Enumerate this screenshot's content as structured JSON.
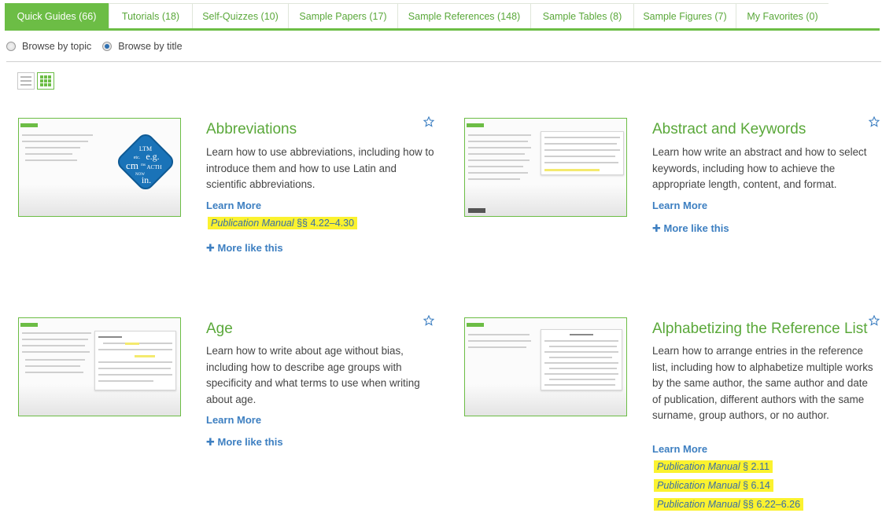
{
  "tabs": [
    {
      "label": "Quick Guides (66)",
      "active": true
    },
    {
      "label": "Tutorials (18)",
      "active": false
    },
    {
      "label": "Self-Quizzes (10)",
      "active": false
    },
    {
      "label": "Sample Papers (17)",
      "active": false
    },
    {
      "label": "Sample References (148)",
      "active": false
    },
    {
      "label": "Sample Tables (8)",
      "active": false
    },
    {
      "label": "Sample Figures (7)",
      "active": false
    },
    {
      "label": "My Favorites (0)",
      "active": false
    }
  ],
  "browse": {
    "by_topic": "Browse by topic",
    "by_title": "Browse by title",
    "selected": "by_title"
  },
  "view": {
    "list_icon": "list-view-icon",
    "grid_icon": "grid-view-icon",
    "selected": "grid"
  },
  "colors": {
    "accent": "#6cbd45",
    "link": "#3d7fc1",
    "highlight": "#fbf22f"
  },
  "thumb_badge": {
    "text": "LTM etc. e.g. cm ms ACTH NOW in."
  },
  "cards": [
    {
      "title": "Abbreviations",
      "description": "Learn how to use abbreviations, including how to introduce them and how to use Latin and scientific abbreviations.",
      "learn_more": "Learn More",
      "refs": [
        {
          "prefix": "Publication Manual",
          "section": " §§ 4.22–4.30"
        }
      ],
      "more_like_this": "More like this"
    },
    {
      "title": "Abstract and Keywords",
      "description": "Learn how write an abstract and how to select keywords, including how to achieve the appropriate length, content, and format.",
      "learn_more": "Learn More",
      "refs": [],
      "more_like_this": "More like this"
    },
    {
      "title": "Age",
      "description": "Learn how to write about age without bias, including how to describe age groups with specificity and what terms to use when writing about age.",
      "learn_more": "Learn More",
      "refs": [],
      "more_like_this": "More like this"
    },
    {
      "title": "Alphabetizing the Reference List",
      "description": "Learn how to arrange entries in the reference list, including how to alphabetize multiple works by the same author, the same author and date of publication, different authors with the same surname, group authors, or no author.",
      "learn_more": "Learn More",
      "refs": [
        {
          "prefix": "Publication Manual",
          "section": " § 2.11"
        },
        {
          "prefix": "Publication Manual",
          "section": " § 6.14"
        },
        {
          "prefix": "Publication Manual",
          "section": " §§ 6.22–6.26"
        }
      ],
      "more_like_this": ""
    }
  ]
}
